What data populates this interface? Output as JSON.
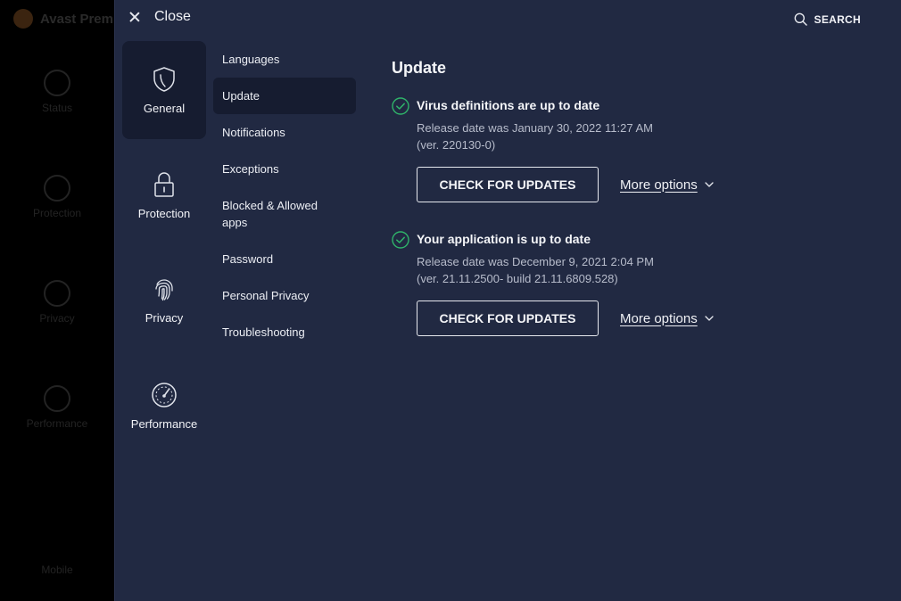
{
  "background_app": {
    "logo_text": "Avast Premi",
    "nav": [
      "Status",
      "Protection",
      "Privacy",
      "Performance",
      "Mobile"
    ]
  },
  "topbar": {
    "close_label": "Close",
    "search_label": "SEARCH"
  },
  "categories": [
    {
      "label": "General",
      "icon": "shield-icon",
      "active": true
    },
    {
      "label": "Protection",
      "icon": "lock-icon",
      "active": false
    },
    {
      "label": "Privacy",
      "icon": "fingerprint-icon",
      "active": false
    },
    {
      "label": "Performance",
      "icon": "speedometer-icon",
      "active": false
    }
  ],
  "submenu": [
    {
      "label": "Languages"
    },
    {
      "label": "Update",
      "active": true
    },
    {
      "label": "Notifications"
    },
    {
      "label": "Exceptions"
    },
    {
      "label": "Blocked & Allowed apps"
    },
    {
      "label": "Password"
    },
    {
      "label": "Personal Privacy"
    },
    {
      "label": "Troubleshooting"
    }
  ],
  "main": {
    "title": "Update",
    "blocks": [
      {
        "title": "Virus definitions are up to date",
        "release": "Release date was January 30, 2022 11:27 AM",
        "version": "(ver. 220130-0)",
        "button": "CHECK FOR UPDATES",
        "more": "More options"
      },
      {
        "title": "Your application is up to date",
        "release": "Release date was December 9, 2021 2:04 PM",
        "version": "(ver. 21.11.2500- build 21.11.6809.528)",
        "button": "CHECK FOR UPDATES",
        "more": "More options"
      }
    ]
  },
  "colors": {
    "overlay_bg": "#212942",
    "active_bg": "#161c30",
    "check_green": "#2fb36a"
  }
}
